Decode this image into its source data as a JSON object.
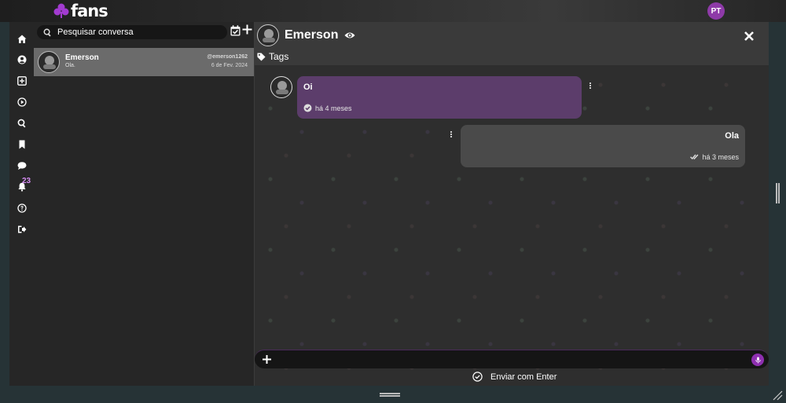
{
  "brand": {
    "name": "fans",
    "accent": "#8e2fb0"
  },
  "user": {
    "initials": "PT"
  },
  "nav": {
    "items": [
      {
        "icon": "home-icon"
      },
      {
        "icon": "user-circle-icon"
      },
      {
        "icon": "plus-square-icon"
      },
      {
        "icon": "play-circle-icon"
      },
      {
        "icon": "search-icon"
      },
      {
        "icon": "bookmark-icon"
      },
      {
        "icon": "chat-bubble-icon"
      },
      {
        "icon": "bell-icon",
        "badge": "23"
      },
      {
        "icon": "help-icon"
      },
      {
        "icon": "logout-icon"
      }
    ]
  },
  "conversations": {
    "search_placeholder": "Pesquisar conversa",
    "items": [
      {
        "name": "Emerson",
        "handle": "@emerson1262",
        "preview": "Ola.",
        "date": "6 de Fev. 2024"
      }
    ]
  },
  "chat": {
    "title": "Emerson",
    "tags_label": "Tags",
    "messages": [
      {
        "direction": "in",
        "text": "Oi",
        "time": "há 4 meses"
      },
      {
        "direction": "out",
        "text": "Ola",
        "time": "há 3 meses"
      }
    ],
    "composer_placeholder": "",
    "enter_label": "Enviar com Enter"
  }
}
